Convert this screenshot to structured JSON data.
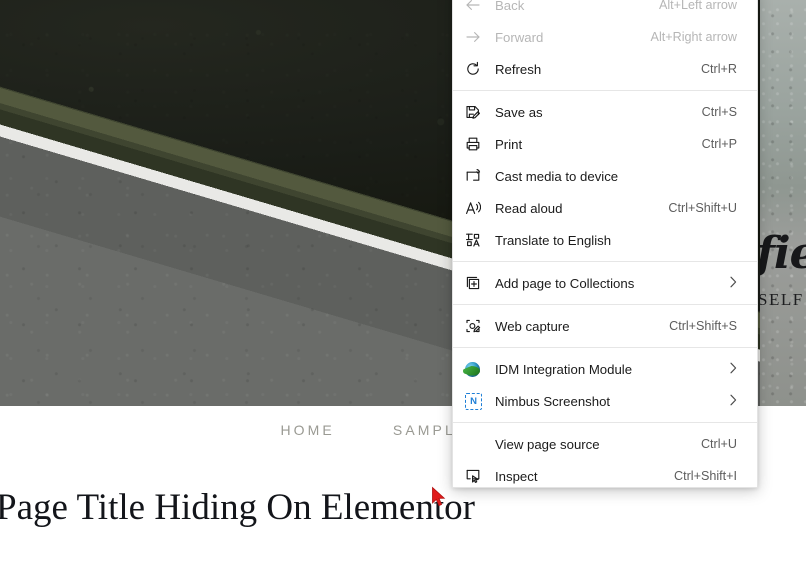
{
  "site": {
    "hero": {
      "left_slide_alt": "dark-forest-road-photo",
      "right_slide": {
        "script_text": "fie",
        "caps_text": "SELF"
      }
    },
    "nav": {
      "items": [
        {
          "label": "HOME"
        },
        {
          "label": "SAMPLE PAGE"
        }
      ]
    },
    "page_title": "Page Title Hiding On Elementor"
  },
  "context_menu": {
    "groups": [
      {
        "items": [
          {
            "icon": "arrow-left-icon",
            "label": "Back",
            "shortcut": "Alt+Left arrow",
            "disabled": true,
            "submenu": false
          },
          {
            "icon": "arrow-right-icon",
            "label": "Forward",
            "shortcut": "Alt+Right arrow",
            "disabled": true,
            "submenu": false
          },
          {
            "icon": "refresh-icon",
            "label": "Refresh",
            "shortcut": "Ctrl+R",
            "disabled": false,
            "submenu": false
          }
        ]
      },
      {
        "items": [
          {
            "icon": "save-icon",
            "label": "Save as",
            "shortcut": "Ctrl+S",
            "disabled": false,
            "submenu": false
          },
          {
            "icon": "print-icon",
            "label": "Print",
            "shortcut": "Ctrl+P",
            "disabled": false,
            "submenu": false
          },
          {
            "icon": "cast-icon",
            "label": "Cast media to device",
            "shortcut": "",
            "disabled": false,
            "submenu": false
          },
          {
            "icon": "read-aloud-icon",
            "label": "Read aloud",
            "shortcut": "Ctrl+Shift+U",
            "disabled": false,
            "submenu": false
          },
          {
            "icon": "translate-icon",
            "label": "Translate to English",
            "shortcut": "",
            "disabled": false,
            "submenu": false
          }
        ]
      },
      {
        "items": [
          {
            "icon": "collections-icon",
            "label": "Add page to Collections",
            "shortcut": "",
            "disabled": false,
            "submenu": true
          }
        ]
      },
      {
        "items": [
          {
            "icon": "web-capture-icon",
            "label": "Web capture",
            "shortcut": "Ctrl+Shift+S",
            "disabled": false,
            "submenu": false
          }
        ]
      },
      {
        "items": [
          {
            "icon": "idm-globe-icon",
            "label": "IDM Integration Module",
            "shortcut": "",
            "disabled": false,
            "submenu": true
          },
          {
            "icon": "nimbus-icon",
            "label": "Nimbus Screenshot",
            "shortcut": "",
            "disabled": false,
            "submenu": true
          }
        ]
      },
      {
        "items": [
          {
            "icon": "none",
            "label": "View page source",
            "shortcut": "Ctrl+U",
            "disabled": false,
            "submenu": false
          },
          {
            "icon": "inspect-icon",
            "label": "Inspect",
            "shortcut": "Ctrl+Shift+I",
            "disabled": false,
            "submenu": false
          }
        ]
      }
    ]
  },
  "cursor": {
    "name": "mouse-pointer",
    "color": "#e01b1b"
  }
}
